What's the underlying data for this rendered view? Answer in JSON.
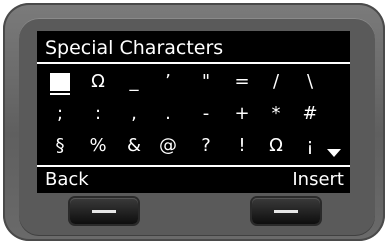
{
  "screen": {
    "title": "Special Characters",
    "rows": [
      [
        "",
        "Ω",
        "_",
        "’",
        "\"",
        "=",
        "/",
        "\\"
      ],
      [
        ";",
        ":",
        ",",
        ".",
        "-",
        "+",
        "*",
        "#"
      ],
      [
        "§",
        "%",
        "&",
        "@",
        "?",
        "!",
        "Ω",
        "¡"
      ]
    ],
    "selected": {
      "row": 0,
      "col": 0
    },
    "has_more_indicator": "chevron-down-icon"
  },
  "softkeys": {
    "left_label": "Back",
    "right_label": "Insert"
  },
  "hardware": {
    "left_key_icon": "minus-icon",
    "right_key_icon": "minus-icon"
  }
}
